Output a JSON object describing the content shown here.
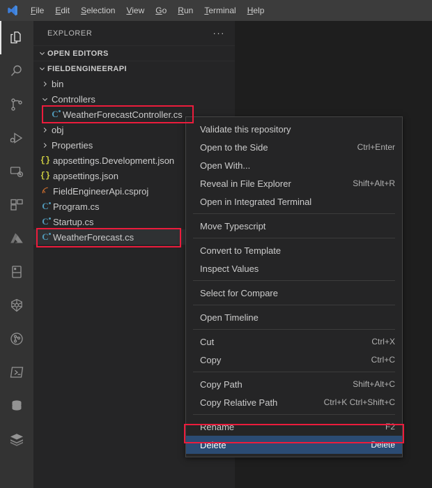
{
  "window": {
    "logo_icon": "vscode-logo"
  },
  "menubar": {
    "items": [
      {
        "label": "File",
        "mnemonic": "F",
        "rest": "ile"
      },
      {
        "label": "Edit",
        "mnemonic": "E",
        "rest": "dit"
      },
      {
        "label": "Selection",
        "mnemonic": "S",
        "rest": "election"
      },
      {
        "label": "View",
        "mnemonic": "V",
        "rest": "iew"
      },
      {
        "label": "Go",
        "mnemonic": "G",
        "rest": "o"
      },
      {
        "label": "Run",
        "mnemonic": "R",
        "rest": "un"
      },
      {
        "label": "Terminal",
        "mnemonic": "T",
        "rest": "erminal"
      },
      {
        "label": "Help",
        "mnemonic": "H",
        "rest": "elp"
      }
    ]
  },
  "activitybar": {
    "items": [
      {
        "name": "explorer",
        "icon": "files-icon",
        "active": true
      },
      {
        "name": "search",
        "icon": "search-icon",
        "active": false
      },
      {
        "name": "source-control",
        "icon": "source-control-icon",
        "active": false
      },
      {
        "name": "run-and-debug",
        "icon": "run-debug-icon",
        "active": false
      },
      {
        "name": "remote-explorer",
        "icon": "remote-explorer-icon",
        "active": false
      },
      {
        "name": "extensions",
        "icon": "extensions-icon",
        "active": false
      },
      {
        "name": "azure",
        "icon": "azure-icon",
        "active": false
      },
      {
        "name": "panel-layout",
        "icon": "panel-layout-icon",
        "active": false
      },
      {
        "name": "kubernetes",
        "icon": "kubernetes-icon",
        "active": false
      },
      {
        "name": "gitlens",
        "icon": "gitlens-icon",
        "active": false
      },
      {
        "name": "powershell",
        "icon": "powershell-icon",
        "active": false
      },
      {
        "name": "database",
        "icon": "database-icon",
        "active": false
      },
      {
        "name": "docker",
        "icon": "docker-icon",
        "active": false
      }
    ]
  },
  "sidebar": {
    "title": "EXPLORER",
    "more_actions": "···",
    "sections": [
      {
        "label": "OPEN EDITORS",
        "expanded": true
      },
      {
        "label": "FIELDENGINEERAPI",
        "expanded": true
      }
    ],
    "tree": [
      {
        "label": "bin",
        "type": "folder",
        "expanded": false,
        "indent": 1,
        "icon": "chevron-right-icon",
        "selected": false
      },
      {
        "label": "Controllers",
        "type": "folder",
        "expanded": true,
        "indent": 1,
        "icon": "chevron-down-icon",
        "selected": false
      },
      {
        "label": "WeatherForecastController.cs",
        "type": "file",
        "indent": 2,
        "icon": "csharp-icon",
        "selected": false,
        "annotated": true
      },
      {
        "label": "obj",
        "type": "folder",
        "expanded": false,
        "indent": 1,
        "icon": "chevron-right-icon",
        "selected": false
      },
      {
        "label": "Properties",
        "type": "folder",
        "expanded": false,
        "indent": 1,
        "icon": "chevron-right-icon",
        "selected": false
      },
      {
        "label": "appsettings.Development.json",
        "type": "file",
        "indent": 1,
        "icon": "json-icon",
        "selected": false
      },
      {
        "label": "appsettings.json",
        "type": "file",
        "indent": 1,
        "icon": "json-icon",
        "selected": false
      },
      {
        "label": "FieldEngineerApi.csproj",
        "type": "file",
        "indent": 1,
        "icon": "csproj-icon",
        "selected": false
      },
      {
        "label": "Program.cs",
        "type": "file",
        "indent": 1,
        "icon": "csharp-icon",
        "selected": false
      },
      {
        "label": "Startup.cs",
        "type": "file",
        "indent": 1,
        "icon": "csharp-icon",
        "selected": false
      },
      {
        "label": "WeatherForecast.cs",
        "type": "file",
        "indent": 1,
        "icon": "csharp-icon",
        "selected": true,
        "annotated": true
      }
    ]
  },
  "context_menu": {
    "rows": [
      {
        "type": "item",
        "label": "Validate this repository",
        "shortcut": ""
      },
      {
        "type": "item",
        "label": "Open to the Side",
        "shortcut": "Ctrl+Enter"
      },
      {
        "type": "item",
        "label": "Open With...",
        "shortcut": ""
      },
      {
        "type": "item",
        "label": "Reveal in File Explorer",
        "shortcut": "Shift+Alt+R"
      },
      {
        "type": "item",
        "label": "Open in Integrated Terminal",
        "shortcut": ""
      },
      {
        "type": "separator"
      },
      {
        "type": "item",
        "label": "Move Typescript",
        "shortcut": ""
      },
      {
        "type": "separator"
      },
      {
        "type": "item",
        "label": "Convert to Template",
        "shortcut": ""
      },
      {
        "type": "item",
        "label": "Inspect Values",
        "shortcut": ""
      },
      {
        "type": "separator"
      },
      {
        "type": "item",
        "label": "Select for Compare",
        "shortcut": ""
      },
      {
        "type": "separator"
      },
      {
        "type": "item",
        "label": "Open Timeline",
        "shortcut": ""
      },
      {
        "type": "separator"
      },
      {
        "type": "item",
        "label": "Cut",
        "shortcut": "Ctrl+X"
      },
      {
        "type": "item",
        "label": "Copy",
        "shortcut": "Ctrl+C"
      },
      {
        "type": "separator"
      },
      {
        "type": "item",
        "label": "Copy Path",
        "shortcut": "Shift+Alt+C"
      },
      {
        "type": "item",
        "label": "Copy Relative Path",
        "shortcut": "Ctrl+K Ctrl+Shift+C"
      },
      {
        "type": "separator"
      },
      {
        "type": "item",
        "label": "Rename",
        "shortcut": "F2"
      },
      {
        "type": "item",
        "label": "Delete",
        "shortcut": "Delete",
        "highlighted": true
      }
    ]
  },
  "annotations": {
    "color": "#ec1c3c",
    "boxes": [
      {
        "target": "WeatherForecastController.cs"
      },
      {
        "target": "WeatherForecast.cs"
      },
      {
        "target": "Delete"
      }
    ]
  },
  "colors": {
    "titlebar_bg": "#3c3c3c",
    "activitybar_bg": "#333333",
    "sidebar_bg": "#252526",
    "editor_bg": "#1e1e1e",
    "menu_highlight": "#2b4b73",
    "annotation_red": "#ec1c3c",
    "text": "#cccccc"
  }
}
